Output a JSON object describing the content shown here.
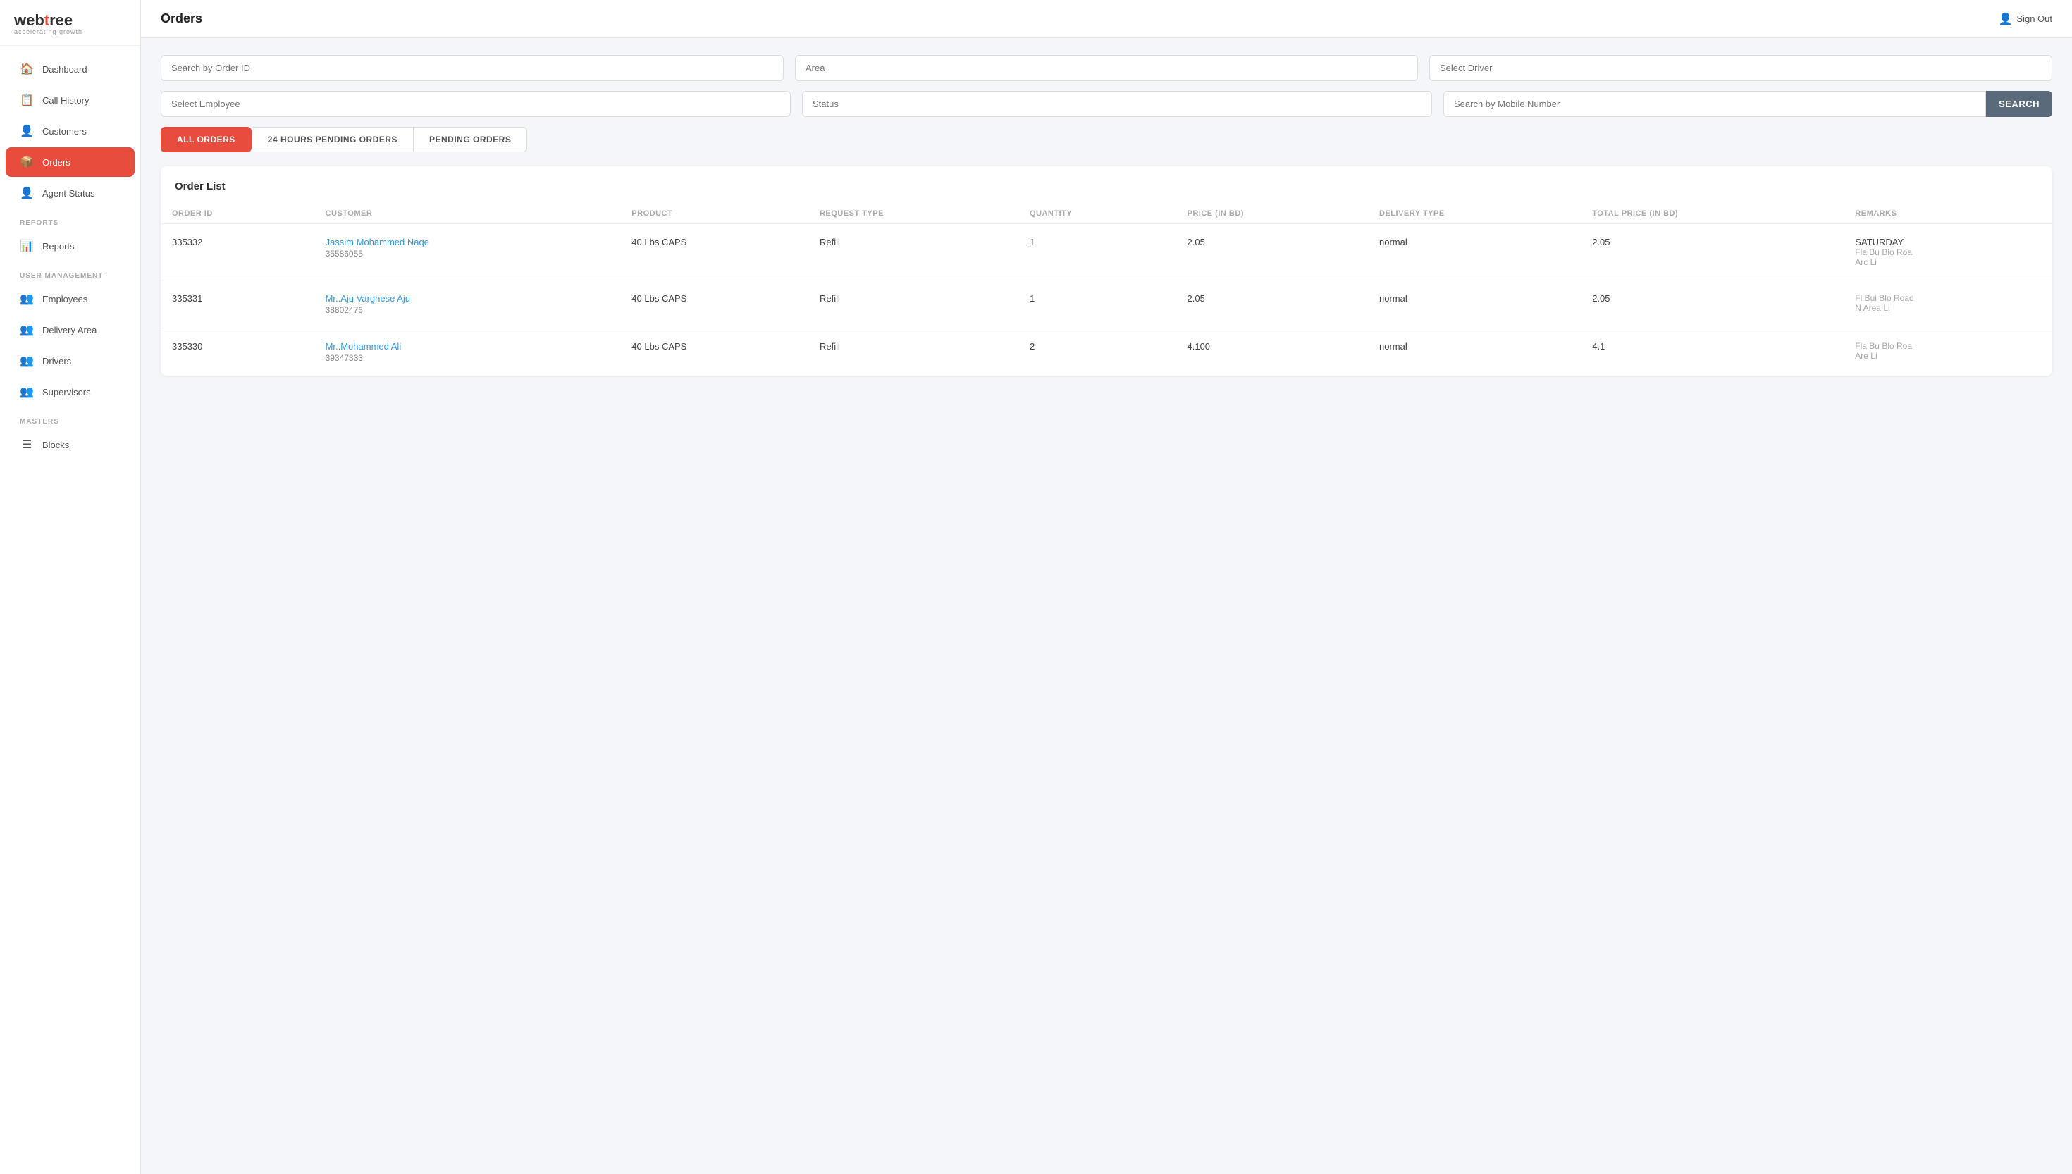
{
  "app": {
    "logo_main": "webtree",
    "logo_sub": "accelerating growth",
    "sign_out_label": "Sign Out"
  },
  "sidebar": {
    "items": [
      {
        "id": "dashboard",
        "label": "Dashboard",
        "icon": "🏠",
        "active": false
      },
      {
        "id": "call-history",
        "label": "Call History",
        "icon": "📋",
        "active": false
      },
      {
        "id": "customers",
        "label": "Customers",
        "icon": "👤",
        "active": false
      },
      {
        "id": "orders",
        "label": "Orders",
        "icon": "📦",
        "active": true
      },
      {
        "id": "agent-status",
        "label": "Agent Status",
        "icon": "👤",
        "active": false
      }
    ],
    "sections": [
      {
        "label": "REPORTS",
        "items": [
          {
            "id": "reports",
            "label": "Reports",
            "icon": "📊",
            "active": false
          }
        ]
      },
      {
        "label": "USER MANAGEMENT",
        "items": [
          {
            "id": "employees",
            "label": "Employees",
            "icon": "👥",
            "active": false
          },
          {
            "id": "delivery-area",
            "label": "Delivery Area",
            "icon": "👥",
            "active": false
          },
          {
            "id": "drivers",
            "label": "Drivers",
            "icon": "👥",
            "active": false
          },
          {
            "id": "supervisors",
            "label": "Supervisors",
            "icon": "👥",
            "active": false
          }
        ]
      },
      {
        "label": "MASTERS",
        "items": [
          {
            "id": "blocks",
            "label": "Blocks",
            "icon": "☰",
            "active": false
          }
        ]
      }
    ]
  },
  "header": {
    "page_title": "Orders"
  },
  "filters": {
    "order_id_placeholder": "Search by Order ID",
    "area_placeholder": "Area",
    "driver_placeholder": "Select Driver",
    "employee_placeholder": "Select Employee",
    "status_placeholder": "Status",
    "mobile_placeholder": "Search by Mobile Number",
    "search_button": "SEARCH"
  },
  "tabs": [
    {
      "id": "all-orders",
      "label": "ALL ORDERS",
      "active": true
    },
    {
      "id": "24h-pending",
      "label": "24 HOURS PENDING ORDERS",
      "active": false
    },
    {
      "id": "pending",
      "label": "PENDING ORDERS",
      "active": false
    }
  ],
  "order_list": {
    "title": "Order List",
    "columns": [
      "ORDER ID",
      "CUSTOMER",
      "PRODUCT",
      "REQUEST TYPE",
      "QUANTITY",
      "PRICE (IN BD)",
      "DELIVERY TYPE",
      "TOTAL PRICE (IN BD)",
      "REMARKS"
    ],
    "rows": [
      {
        "order_id": "335332",
        "customer_name": "Jassim Mohammed Naqe",
        "customer_phone": "35586055",
        "product": "40 Lbs CAPS",
        "request_type": "Refill",
        "quantity": "1",
        "price": "2.05",
        "delivery_type": "normal",
        "total_price": "2.05",
        "remarks": "SATURDAY",
        "remarks_extra": "Fla Bu Blo Roa Arc Li"
      },
      {
        "order_id": "335331",
        "customer_name": "Mr..Aju Varghese Aju",
        "customer_phone": "38802476",
        "product": "40 Lbs CAPS",
        "request_type": "Refill",
        "quantity": "1",
        "price": "2.05",
        "delivery_type": "normal",
        "total_price": "2.05",
        "remarks": "",
        "remarks_extra": "Fl Bui Blo Road N Area Li"
      },
      {
        "order_id": "335330",
        "customer_name": "Mr..Mohammed Ali",
        "customer_phone": "39347333",
        "product": "40 Lbs CAPS",
        "request_type": "Refill",
        "quantity": "2",
        "price": "4.100",
        "delivery_type": "normal",
        "total_price": "4.1",
        "remarks": "",
        "remarks_extra": "Fla Bu Blo Roa Are Li"
      }
    ]
  }
}
